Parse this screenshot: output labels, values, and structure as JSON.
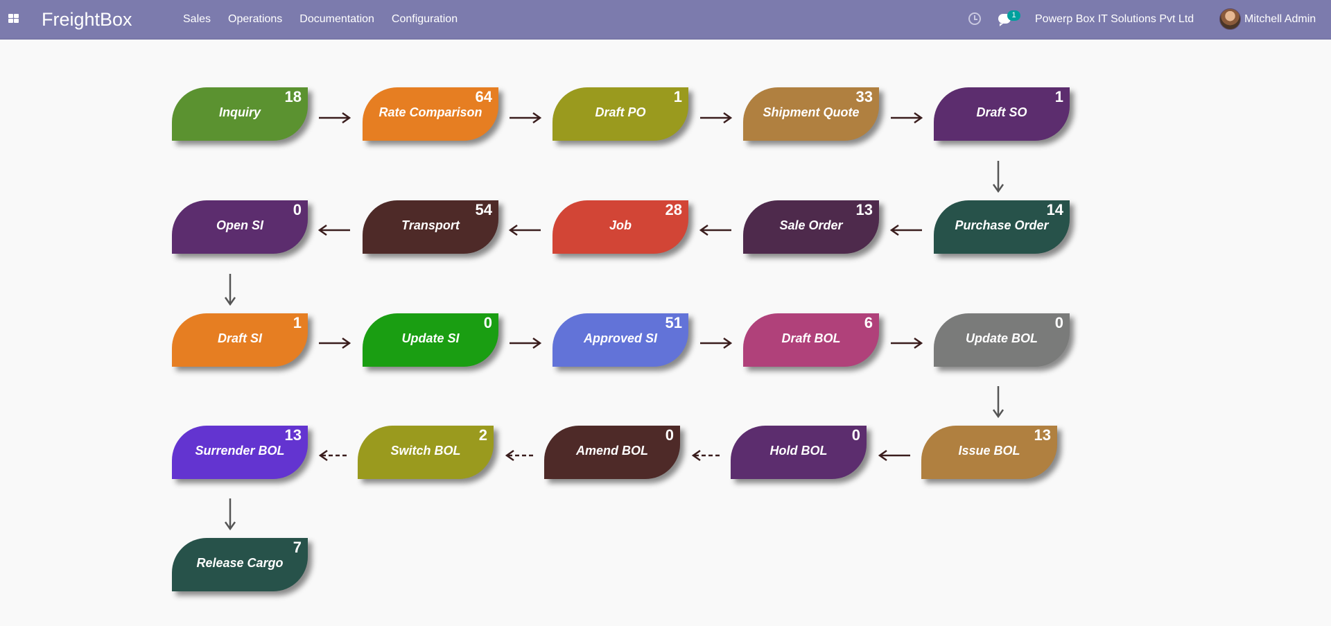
{
  "nav": {
    "brand": "FreightBox",
    "menu": [
      "Sales",
      "Operations",
      "Documentation",
      "Configuration"
    ],
    "chat_badge": "1",
    "company": "Powerp Box IT Solutions Pvt Ltd",
    "user": "Mitchell Admin"
  },
  "colors": {
    "topbar": "#7c7bad",
    "background": "#f9f9f9",
    "arrow_dark": "#3a1d1d",
    "arrow_gray": "#555555"
  },
  "flow": [
    {
      "label": "Inquiry",
      "count": "18",
      "color": "#5b9230"
    },
    {
      "label": "Rate Comparison",
      "count": "64",
      "color": "#e67e22"
    },
    {
      "label": "Draft PO",
      "count": "1",
      "color": "#9a9a1e"
    },
    {
      "label": "Shipment Quote",
      "count": "33",
      "color": "#b08040"
    },
    {
      "label": "Draft SO",
      "count": "1",
      "color": "#5c2d6e"
    },
    {
      "label": "Purchase Order",
      "count": "14",
      "color": "#27524a"
    },
    {
      "label": "Sale Order",
      "count": "13",
      "color": "#4e2a4c"
    },
    {
      "label": "Job",
      "count": "28",
      "color": "#d24536"
    },
    {
      "label": "Transport",
      "count": "54",
      "color": "#4e2a28"
    },
    {
      "label": "Open SI",
      "count": "0",
      "color": "#5c2d6e"
    },
    {
      "label": "Draft SI",
      "count": "1",
      "color": "#e67e22"
    },
    {
      "label": "Update SI",
      "count": "0",
      "color": "#1a9e12"
    },
    {
      "label": "Approved SI",
      "count": "51",
      "color": "#6273d8"
    },
    {
      "label": "Draft BOL",
      "count": "6",
      "color": "#b0417a"
    },
    {
      "label": "Update BOL",
      "count": "0",
      "color": "#7a7b7a"
    },
    {
      "label": "Issue BOL",
      "count": "13",
      "color": "#b08040"
    },
    {
      "label": "Hold BOL",
      "count": "0",
      "color": "#5c2d6e"
    },
    {
      "label": "Amend BOL",
      "count": "0",
      "color": "#4e2a28"
    },
    {
      "label": "Switch BOL",
      "count": "2",
      "color": "#9a9a1e"
    },
    {
      "label": "Surrender BOL",
      "count": "13",
      "color": "#6334d0"
    },
    {
      "label": "Release Cargo",
      "count": "7",
      "color": "#27524a"
    }
  ]
}
